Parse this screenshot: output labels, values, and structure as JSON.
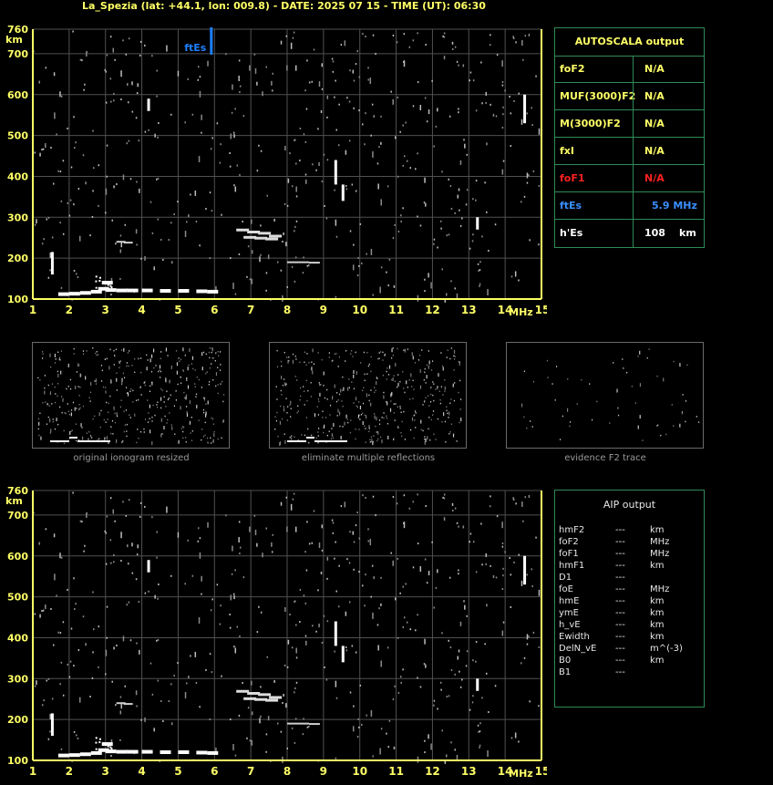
{
  "header": {
    "title": "La_Spezia (lat: +44.1, lon: 009.8) - DATE: 2025 07 15 - TIME (UT): 06:30"
  },
  "chart_data": [
    {
      "type": "scatter",
      "name": "top-ionogram",
      "xlabel": "MHz",
      "ylabel": "km",
      "xlim": [
        1,
        15
      ],
      "ylim": [
        100,
        760
      ],
      "xticks": [
        1,
        2,
        3,
        4,
        5,
        6,
        7,
        8,
        9,
        10,
        11,
        12,
        13,
        14,
        15
      ],
      "yticks": [
        100,
        200,
        300,
        400,
        500,
        600,
        700,
        760
      ],
      "grid": true,
      "annotation": {
        "label": "ftEs",
        "x": 5.9
      }
    },
    {
      "type": "scatter",
      "name": "bottom-ionogram",
      "xlabel": "MHz",
      "ylabel": "km",
      "xlim": [
        1,
        15
      ],
      "ylim": [
        100,
        760
      ],
      "xticks": [
        1,
        2,
        3,
        4,
        5,
        6,
        7,
        8,
        9,
        10,
        11,
        12,
        13,
        14,
        15
      ],
      "yticks": [
        100,
        200,
        300,
        400,
        500,
        600,
        700,
        760
      ],
      "grid": true
    }
  ],
  "thumbnails": [
    {
      "caption": "original ionogram resized"
    },
    {
      "caption": "eliminate multiple reflections"
    },
    {
      "caption": "evidence F2 trace"
    }
  ],
  "autoscala": {
    "heading": "AUTOSCALA output",
    "rows": [
      {
        "label": "foF2",
        "value": "N/A",
        "unit": "",
        "color": "#ffff66"
      },
      {
        "label": "MUF(3000)F2",
        "value": "N/A",
        "unit": "",
        "color": "#ffff66"
      },
      {
        "label": "M(3000)F2",
        "value": "N/A",
        "unit": "",
        "color": "#ffff66"
      },
      {
        "label": "fxI",
        "value": "N/A",
        "unit": "",
        "color": "#ffff66"
      },
      {
        "label": "foF1",
        "value": "N/A",
        "unit": "",
        "color": "#ff2020"
      },
      {
        "label": "ftEs",
        "value": "5.9 MHz",
        "unit": "",
        "color": "#3a8fff"
      },
      {
        "label": "h'Es",
        "value": "108",
        "unit": "km",
        "color": "#ffffff"
      }
    ]
  },
  "aip": {
    "heading": "AIP output",
    "rows": [
      {
        "label": "hmF2",
        "value": "---",
        "unit": "km"
      },
      {
        "label": "foF2",
        "value": "---",
        "unit": "MHz"
      },
      {
        "label": "foF1",
        "value": "---",
        "unit": "MHz"
      },
      {
        "label": "hmF1",
        "value": "---",
        "unit": "km"
      },
      {
        "label": "D1",
        "value": "---",
        "unit": ""
      },
      {
        "label": "foE",
        "value": "---",
        "unit": "MHz"
      },
      {
        "label": "hmE",
        "value": "---",
        "unit": "km"
      },
      {
        "label": "ymE",
        "value": "---",
        "unit": "km"
      },
      {
        "label": "h_vE",
        "value": "---",
        "unit": "km"
      },
      {
        "label": "Ewidth",
        "value": "---",
        "unit": "km"
      },
      {
        "label": "DelN_vE",
        "value": "---",
        "unit": "m^(-3)"
      },
      {
        "label": "B0",
        "value": "---",
        "unit": "km"
      },
      {
        "label": "B1",
        "value": "---",
        "unit": ""
      }
    ]
  },
  "colors": {
    "axis": "#ffff66",
    "grid": "#505050",
    "frame": "#2e8b57",
    "echo": "#ffffff",
    "es_marker": "#1e7fff"
  }
}
